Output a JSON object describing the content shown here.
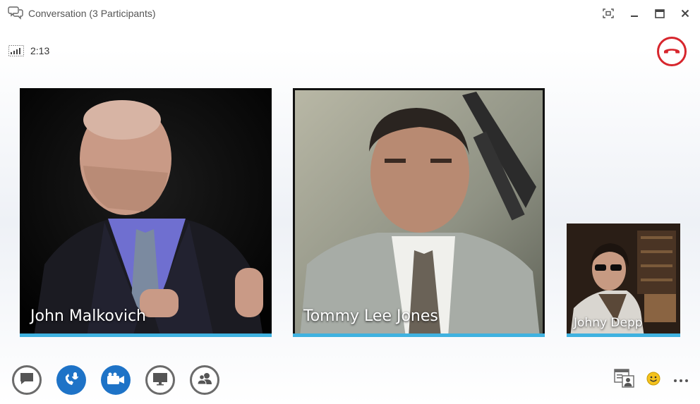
{
  "window": {
    "title": "Conversation (3 Participants)",
    "icons": {
      "app": "conversation-bubbles-icon",
      "fullscreen": "fullscreen-icon",
      "minimize": "minimize-icon",
      "maximize": "maximize-icon",
      "close": "close-icon"
    }
  },
  "call": {
    "duration": "2:13",
    "quality_icon": "call-quality-signal-icon",
    "hangup_icon": "hang-up-phone-icon",
    "hangup_color": "#d7262d"
  },
  "participants": [
    {
      "name": "John Malkovich"
    },
    {
      "name": "Tommy Lee Jones"
    },
    {
      "name": "Johny Depp"
    }
  ],
  "colors": {
    "accent": "#3fb2e0",
    "active_button": "#1e73c7",
    "outline_button": "#6b6b6b"
  },
  "toolbar": {
    "buttons": [
      {
        "icon": "im-chat-icon",
        "state": "off"
      },
      {
        "icon": "microphone-icon",
        "state": "on"
      },
      {
        "icon": "video-camera-icon",
        "state": "on"
      },
      {
        "icon": "present-screen-icon",
        "state": "off"
      },
      {
        "icon": "participants-icon",
        "state": "off"
      }
    ],
    "right": [
      {
        "icon": "contact-card-icon"
      },
      {
        "icon": "emoticon-smiley-icon"
      },
      {
        "icon": "more-options-icon"
      }
    ]
  }
}
